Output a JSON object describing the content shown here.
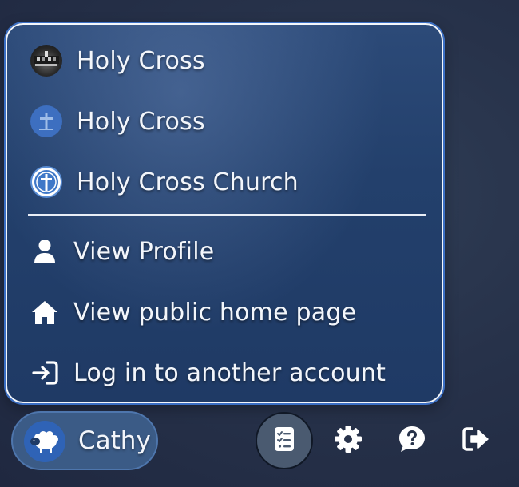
{
  "menu": {
    "accounts": [
      {
        "label": "Holy Cross",
        "avatar": "church-photo-avatar"
      },
      {
        "label": "Holy Cross",
        "avatar": "cross-blue-avatar"
      },
      {
        "label": "Holy Cross Church",
        "avatar": "cross-circle-avatar"
      }
    ],
    "actions": [
      {
        "label": "View Profile",
        "icon": "person-icon"
      },
      {
        "label": "View public home page",
        "icon": "home-icon"
      },
      {
        "label": "Log in to another account",
        "icon": "login-icon"
      }
    ]
  },
  "bottom_bar": {
    "user_name": "Cathy",
    "user_avatar": "sheep-avatar",
    "tools": [
      {
        "icon": "checklist-icon",
        "active": true
      },
      {
        "icon": "gear-icon",
        "active": false
      },
      {
        "icon": "help-icon",
        "active": false
      },
      {
        "icon": "logout-icon",
        "active": false
      }
    ]
  },
  "colors": {
    "menu_background": "#23406c",
    "menu_border": "#f4f7fb",
    "accent": "#3b6fc4",
    "text": "#f3f6fb"
  }
}
